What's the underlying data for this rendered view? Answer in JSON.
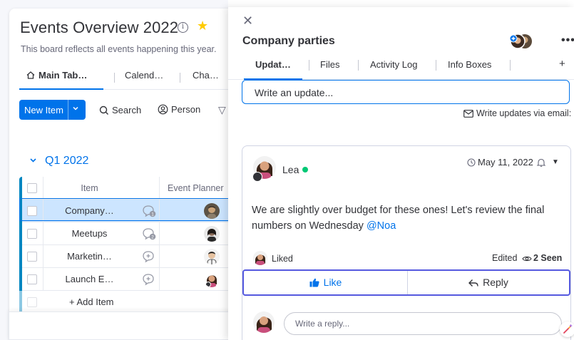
{
  "board": {
    "title": "Events Overview 2022",
    "description": "This board reflects all events happening this year.",
    "tabs": [
      {
        "label": "Main Tab…"
      },
      {
        "label": "Calend…"
      },
      {
        "label": "Cha…"
      }
    ],
    "new_item_label": "New Item",
    "search_label": "Search",
    "person_label": "Person",
    "group": {
      "title": "Q1 2022",
      "color": "#0086c0",
      "columns": {
        "item": "Item",
        "planner": "Event Planner"
      },
      "rows": [
        {
          "name": "Company…",
          "updates": "1",
          "selected": true
        },
        {
          "name": "Meetups",
          "updates": "2",
          "selected": false
        },
        {
          "name": "Marketin…",
          "updates": "",
          "selected": false
        },
        {
          "name": "Launch E…",
          "updates": "",
          "selected": false
        }
      ],
      "add_item_label": "+ Add Item"
    }
  },
  "panel": {
    "title": "Company parties",
    "tabs": [
      {
        "label": "Updat…",
        "active": true
      },
      {
        "label": "Files"
      },
      {
        "label": "Activity Log"
      },
      {
        "label": "Info Boxes"
      }
    ],
    "add_tab_label": "+",
    "write_update_placeholder": "Write an update...",
    "write_via_email": "Write updates via email:",
    "update": {
      "author": "Lea",
      "date": "May 11, 2022",
      "body_text": "We are slightly over budget for these ones! Let's review the final numbers on Wednesday",
      "mention": "@Noa",
      "liked_label": "Liked",
      "edited_label": "Edited",
      "seen_label": "2 Seen",
      "like_button": "Like",
      "reply_button": "Reply",
      "reply_placeholder": "Write a reply..."
    }
  },
  "colors": {
    "primary": "#0073ea",
    "selected_row": "#cce5ff",
    "online": "#00c875",
    "focus_ring": "#5559df",
    "star": "#ffcb00"
  }
}
